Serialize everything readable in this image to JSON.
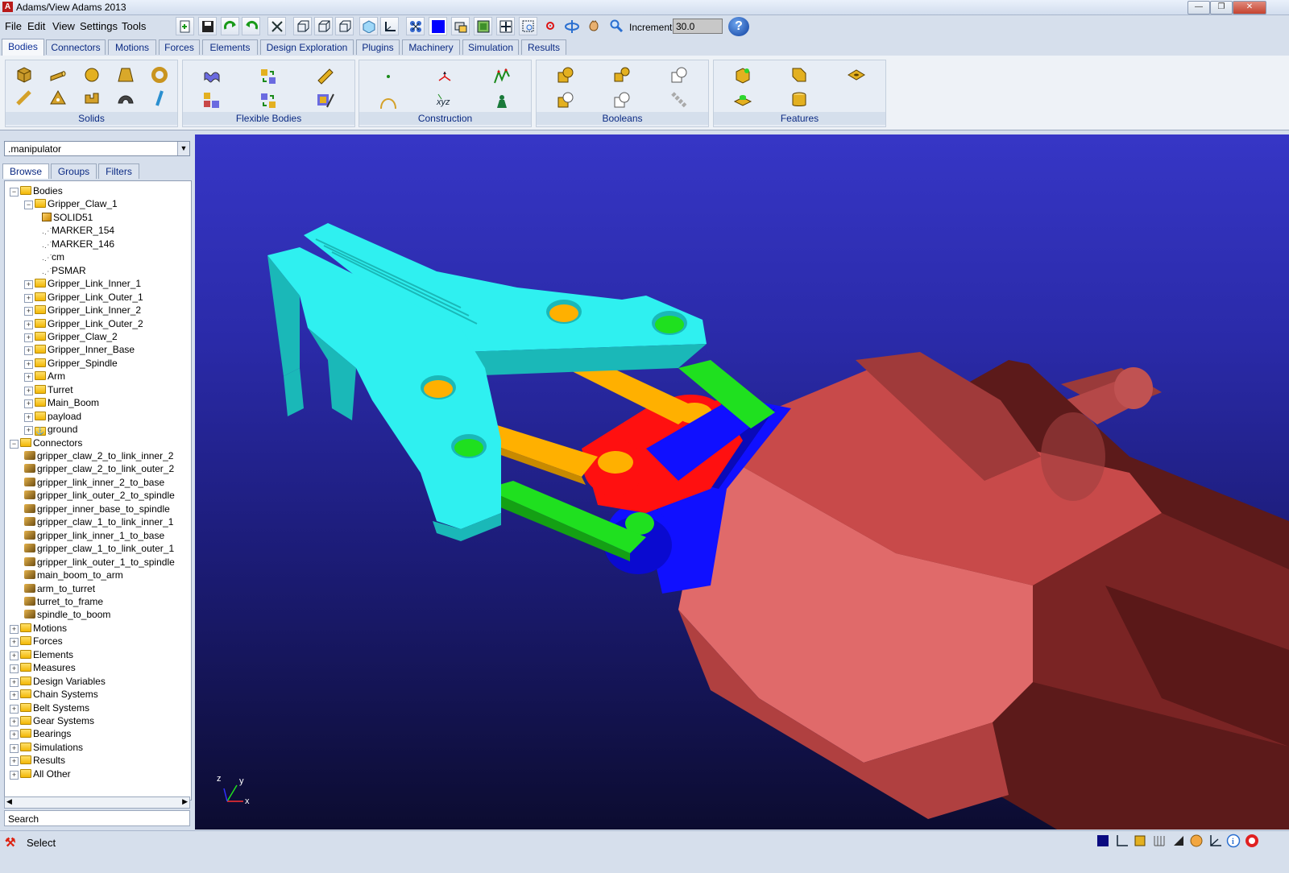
{
  "window": {
    "title": "Adams/View Adams 2013",
    "app_icon_letter": "A",
    "controls": {
      "minimize": "—",
      "maximize": "❐",
      "close": "✕"
    }
  },
  "menu": {
    "items": [
      "File",
      "Edit",
      "View",
      "Settings",
      "Tools"
    ]
  },
  "toolbar": {
    "icons": [
      "new-model-icon",
      "save-icon",
      "redo-icon",
      "undo-icon",
      "select-tools-icon",
      "front-view-icon",
      "iso-view-icon",
      "right-view-icon",
      "solid-cube-icon",
      "triad-icon",
      "hole-icon",
      "blue-render-icon",
      "copy-icon",
      "fit-icon",
      "zoom-fit-icon",
      "zoom-box-icon",
      "center-icon",
      "rotate-icon",
      "pan-icon",
      "zoom-icon"
    ],
    "increment_label": "Increment",
    "increment_value": "30.0",
    "help_label": "?"
  },
  "tabs": [
    "Bodies",
    "Connectors",
    "Motions",
    "Forces",
    "Elements",
    "Design Exploration",
    "Plugins",
    "Machinery",
    "Simulation",
    "Results"
  ],
  "active_tab": "Bodies",
  "ribbon": {
    "groups": [
      "Solids",
      "Flexible Bodies",
      "Construction",
      "Booleans",
      "Features"
    ]
  },
  "browser": {
    "model": ".manipulator",
    "tabs": [
      "Browse",
      "Groups",
      "Filters"
    ],
    "tree": [
      {
        "label": "Bodies",
        "level": 0,
        "type": "folder",
        "expander": "−"
      },
      {
        "label": "Gripper_Claw_1",
        "level": 1,
        "type": "folder",
        "expander": "−"
      },
      {
        "label": "SOLID51",
        "level": 2,
        "type": "cube",
        "expander": ""
      },
      {
        "label": "MARKER_154",
        "level": 2,
        "type": "marker",
        "expander": ""
      },
      {
        "label": "MARKER_146",
        "level": 2,
        "type": "marker",
        "expander": ""
      },
      {
        "label": "cm",
        "level": 2,
        "type": "marker",
        "expander": ""
      },
      {
        "label": "PSMAR",
        "level": 2,
        "type": "marker",
        "expander": ""
      },
      {
        "label": "Gripper_Link_Inner_1",
        "level": 1,
        "type": "folder",
        "expander": "+"
      },
      {
        "label": "Gripper_Link_Outer_1",
        "level": 1,
        "type": "folder",
        "expander": "+"
      },
      {
        "label": "Gripper_Link_Inner_2",
        "level": 1,
        "type": "folder",
        "expander": "+"
      },
      {
        "label": "Gripper_Link_Outer_2",
        "level": 1,
        "type": "folder",
        "expander": "+"
      },
      {
        "label": "Gripper_Claw_2",
        "level": 1,
        "type": "folder",
        "expander": "+"
      },
      {
        "label": "Gripper_Inner_Base",
        "level": 1,
        "type": "folder",
        "expander": "+"
      },
      {
        "label": "Gripper_Spindle",
        "level": 1,
        "type": "folder",
        "expander": "+"
      },
      {
        "label": "Arm",
        "level": 1,
        "type": "folder",
        "expander": "+"
      },
      {
        "label": "Turret",
        "level": 1,
        "type": "folder",
        "expander": "+"
      },
      {
        "label": "Main_Boom",
        "level": 1,
        "type": "folder",
        "expander": "+"
      },
      {
        "label": "payload",
        "level": 1,
        "type": "folder",
        "expander": "+"
      },
      {
        "label": "ground",
        "level": 1,
        "type": "ground",
        "expander": "+"
      },
      {
        "label": "Connectors",
        "level": 0,
        "type": "folder",
        "expander": "−"
      },
      {
        "label": "gripper_claw_2_to_link_inner_2",
        "level": 1,
        "type": "joint",
        "expander": ""
      },
      {
        "label": "gripper_claw_2_to_link_outer_2",
        "level": 1,
        "type": "joint",
        "expander": ""
      },
      {
        "label": "gripper_link_inner_2_to_base",
        "level": 1,
        "type": "joint",
        "expander": ""
      },
      {
        "label": "gripper_link_outer_2_to_spindle",
        "level": 1,
        "type": "joint",
        "expander": ""
      },
      {
        "label": "gripper_inner_base_to_spindle",
        "level": 1,
        "type": "joint",
        "expander": ""
      },
      {
        "label": "gripper_claw_1_to_link_inner_1",
        "level": 1,
        "type": "joint",
        "expander": ""
      },
      {
        "label": "gripper_link_inner_1_to_base",
        "level": 1,
        "type": "joint",
        "expander": ""
      },
      {
        "label": "gripper_claw_1_to_link_outer_1",
        "level": 1,
        "type": "joint",
        "expander": ""
      },
      {
        "label": "gripper_link_outer_1_to_spindle",
        "level": 1,
        "type": "joint",
        "expander": ""
      },
      {
        "label": "main_boom_to_arm",
        "level": 1,
        "type": "joint",
        "expander": ""
      },
      {
        "label": "arm_to_turret",
        "level": 1,
        "type": "joint",
        "expander": ""
      },
      {
        "label": "turret_to_frame",
        "level": 1,
        "type": "joint",
        "expander": ""
      },
      {
        "label": "spindle_to_boom",
        "level": 1,
        "type": "joint",
        "expander": ""
      },
      {
        "label": "Motions",
        "level": 0,
        "type": "folder",
        "expander": "+"
      },
      {
        "label": "Forces",
        "level": 0,
        "type": "folder",
        "expander": "+"
      },
      {
        "label": "Elements",
        "level": 0,
        "type": "folder",
        "expander": "+"
      },
      {
        "label": "Measures",
        "level": 0,
        "type": "folder",
        "expander": "+"
      },
      {
        "label": "Design Variables",
        "level": 0,
        "type": "folder",
        "expander": "+"
      },
      {
        "label": "Chain Systems",
        "level": 0,
        "type": "folder",
        "expander": "+"
      },
      {
        "label": "Belt Systems",
        "level": 0,
        "type": "folder",
        "expander": "+"
      },
      {
        "label": "Gear Systems",
        "level": 0,
        "type": "folder",
        "expander": "+"
      },
      {
        "label": "Bearings",
        "level": 0,
        "type": "folder",
        "expander": "+"
      },
      {
        "label": "Simulations",
        "level": 0,
        "type": "folder",
        "expander": "+"
      },
      {
        "label": "Results",
        "level": 0,
        "type": "folder",
        "expander": "+"
      },
      {
        "label": "All Other",
        "level": 0,
        "type": "folder",
        "expander": "+"
      }
    ],
    "search_placeholder": "Search"
  },
  "viewport": {
    "axes": {
      "z": "z",
      "y": "y",
      "x": "x"
    },
    "colors": {
      "claw": "#2ff0f0",
      "inner_link": "#ffb000",
      "outer_link": "#1fe01f",
      "base": "#ff1010",
      "spindle": "#1010ff",
      "boom": "#c84848"
    }
  },
  "status": {
    "text": "Select"
  }
}
